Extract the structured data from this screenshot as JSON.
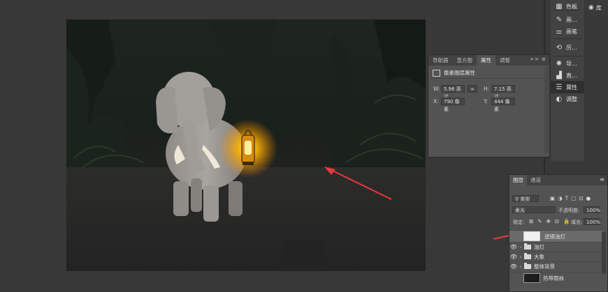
{
  "dock": {
    "items": [
      {
        "icon": "grid-icon",
        "label": "色板"
      },
      {
        "icon": "brush-icon",
        "label": "画..."
      },
      {
        "icon": "brush-settings-icon",
        "label": "画笔"
      },
      {
        "icon": "history-icon",
        "label": "历..."
      },
      {
        "icon": "navigator-icon",
        "label": "导..."
      },
      {
        "icon": "histogram-icon",
        "label": "直..."
      },
      {
        "icon": "properties-icon",
        "label": "属性"
      },
      {
        "icon": "adjustments-icon",
        "label": "调整"
      }
    ],
    "library_label": "库"
  },
  "properties": {
    "tabs": [
      "导航器",
      "直方图",
      "属性",
      "调整"
    ],
    "active_tab": "属性",
    "tab_controls": ">> ≡",
    "layer_type": "像素图层属性",
    "w_label": "W:",
    "w_value": "5.96 英寸",
    "h_label": "H:",
    "h_value": "7.15 英寸",
    "x_label": "X:",
    "x_value": "790 像素",
    "y_label": "Y:",
    "y_value": "444 像素",
    "link_icon": "link-icon"
  },
  "layers": {
    "tabs": [
      "图层",
      "通道"
    ],
    "active_tab": "图层",
    "filter_label": "类型",
    "blend_mode": "柔光",
    "opacity_label": "不透明度:",
    "opacity_value": "100%",
    "lock_label": "锁定:",
    "fill_label": "填充:",
    "fill_value": "100%",
    "items": [
      {
        "name": "滤镜油灯",
        "type": "pixel",
        "visible": false,
        "selected": true
      },
      {
        "name": "油灯",
        "type": "group",
        "visible": true,
        "selected": false
      },
      {
        "name": "大象",
        "type": "group",
        "visible": true,
        "selected": false
      },
      {
        "name": "整体背景",
        "type": "group",
        "visible": true,
        "selected": false
      },
      {
        "name": "热带雨林",
        "type": "pixel",
        "visible": false,
        "selected": false
      }
    ]
  },
  "colors": {
    "ui_dark": "#383838",
    "panel": "#535353",
    "annotation_arrow": "#e63a3a",
    "lantern_glow": "#ffb400"
  }
}
